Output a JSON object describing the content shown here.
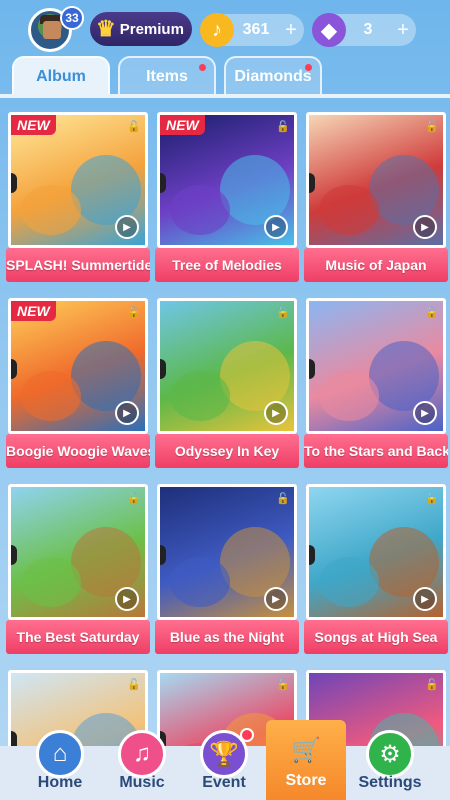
{
  "header": {
    "level": "33",
    "premium_label": "Premium",
    "notes_count": "361",
    "diamonds_count": "3",
    "plus": "+"
  },
  "tabs": [
    {
      "label": "Album",
      "active": true,
      "dot": false
    },
    {
      "label": "Items",
      "active": false,
      "dot": true
    },
    {
      "label": "Diamonds",
      "active": false,
      "dot": true
    }
  ],
  "albums": [
    {
      "title": "SPLASH! Summertide Cafe",
      "new": "NEW",
      "colors": [
        "#ffe89a",
        "#f4a23c",
        "#3aa3d7"
      ]
    },
    {
      "title": "Tree of Melodies",
      "new": "NEW",
      "colors": [
        "#1a1f6b",
        "#6d3fc4",
        "#49c0e8"
      ]
    },
    {
      "title": "Music of Japan",
      "new": "",
      "colors": [
        "#f6d6b6",
        "#cf3b3b",
        "#5b6fa5"
      ]
    },
    {
      "title": "Boogie Woogie Waves",
      "new": "NEW",
      "colors": [
        "#ffce5a",
        "#ef6a2b",
        "#2c6fb8"
      ]
    },
    {
      "title": "Odyssey In Key",
      "new": "",
      "colors": [
        "#6fc6e6",
        "#5cb84a",
        "#e8c33c"
      ]
    },
    {
      "title": "To the Stars and Back",
      "new": "",
      "colors": [
        "#8bb6f2",
        "#e98aa0",
        "#4a63c7"
      ]
    },
    {
      "title": "The Best Saturday",
      "new": "",
      "colors": [
        "#8fd3f0",
        "#6cc04a",
        "#b8773a"
      ]
    },
    {
      "title": "Blue as the Night",
      "new": "",
      "colors": [
        "#1e2f7a",
        "#3f5bc2",
        "#c7903e"
      ]
    },
    {
      "title": "Songs at High Sea",
      "new": "",
      "colors": [
        "#8fd6f0",
        "#3fa7c8",
        "#b56230"
      ]
    },
    {
      "title": "",
      "new": "",
      "colors": [
        "#cfe6f6",
        "#f2c27a",
        "#5d9fd6"
      ]
    },
    {
      "title": "",
      "new": "",
      "colors": [
        "#a6d9f2",
        "#ea4a66",
        "#f29b3a"
      ]
    },
    {
      "title": "",
      "new": "",
      "colors": [
        "#6f45b8",
        "#f05a7e",
        "#46b6a8"
      ]
    }
  ],
  "nav": [
    {
      "label": "Home",
      "icon": "home-icon",
      "glyph": "⌂",
      "color": "#3b7fd6"
    },
    {
      "label": "Music",
      "icon": "music-note-icon",
      "glyph": "♫",
      "color": "#f0508a"
    },
    {
      "label": "Event",
      "icon": "trophy-icon",
      "glyph": "🏆",
      "color": "#7a4fd1"
    },
    {
      "label": "Store",
      "icon": "cart-icon",
      "glyph": "🛒",
      "color": "#f5882a"
    },
    {
      "label": "Settings",
      "icon": "gear-icon",
      "glyph": "⚙",
      "color": "#2fb34a"
    }
  ],
  "icons": {
    "lock": "🔓",
    "play": "▶",
    "crown": "♛",
    "note": "♪",
    "gem": "◆"
  }
}
